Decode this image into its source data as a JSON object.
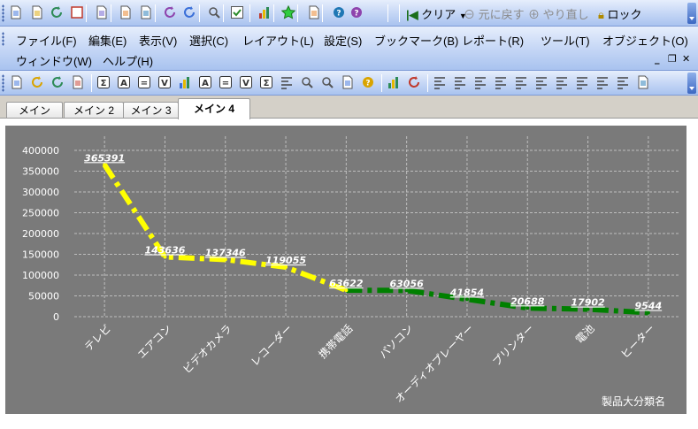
{
  "toolbar1": {
    "icons": [
      "new-icon",
      "open-icon",
      "refresh-icon",
      "save-icon",
      "print-icon",
      "edit-icon",
      "export-icon",
      "undo-icon",
      "redo-icon",
      "search-icon",
      "check-icon",
      "chart-icon",
      "favorite-icon",
      "properties-icon",
      "help-icon",
      "context-help-icon"
    ],
    "clear_label": "クリア",
    "back_label": "元に戻す",
    "redo_label": "やり直し",
    "lock_label": "ロック"
  },
  "menu": {
    "items": [
      "ファイル(F)",
      "編集(E)",
      "表示(V)",
      "選択(C)",
      "レイアウト(L)",
      "設定(S)",
      "ブックマーク(B)",
      "レポート(R)",
      "ツール(T)",
      "オブジェクト(O)",
      "ウィンドウ(W)",
      "ヘルプ(H)"
    ]
  },
  "toolbar2": {
    "icons": [
      "new-sheet-icon",
      "import-icon",
      "export-icon",
      "folder-icon",
      "list-box-icon",
      "sum-icon",
      "table-icon",
      "pivot-icon",
      "bar-chart-icon",
      "input-box-icon",
      "multi-box-icon",
      "current-selection-icon",
      "text-object-icon",
      "line-object-icon",
      "slider-icon",
      "search-object-icon",
      "bookmark-object-icon",
      "statistics-icon",
      "chart-wizard-icon",
      "paint-icon",
      "align-center-icon",
      "align-left-icon",
      "align-right-icon",
      "align-top-icon",
      "align-bottom-icon",
      "distribute-h-icon",
      "distribute-v-icon",
      "space-h-icon",
      "space-v-icon",
      "size-icon",
      "script-icon"
    ]
  },
  "tabs": [
    "メイン",
    "メイン 2",
    "メイン 3",
    "メイン 4"
  ],
  "active_tab": 3,
  "chart_data": {
    "type": "line",
    "categories": [
      "テレビ",
      "エアコン",
      "ビデオカメラ",
      "レコーダー",
      "携帯電話",
      "パソコン",
      "オーディオプレーヤー",
      "プリンター",
      "電池",
      "ヒーター"
    ],
    "values": [
      365391,
      143636,
      137346,
      119055,
      63622,
      63056,
      41854,
      20688,
      17902,
      9544
    ],
    "data_labels": [
      "365391",
      "143636",
      "137346",
      "119055",
      "63622",
      "63056",
      "41854",
      "20688",
      "17902",
      "9544"
    ],
    "xlabel": "製品大分類名",
    "ylabel": "",
    "ylim": [
      0,
      400000
    ],
    "yticks": [
      "0",
      "50000",
      "100000",
      "150000",
      "200000",
      "250000",
      "300000",
      "350000",
      "400000"
    ],
    "grid": true,
    "colors": {
      "high": "#ffff00",
      "low": "#008000",
      "background": "#7a7a7a",
      "text": "#ffffff"
    }
  }
}
